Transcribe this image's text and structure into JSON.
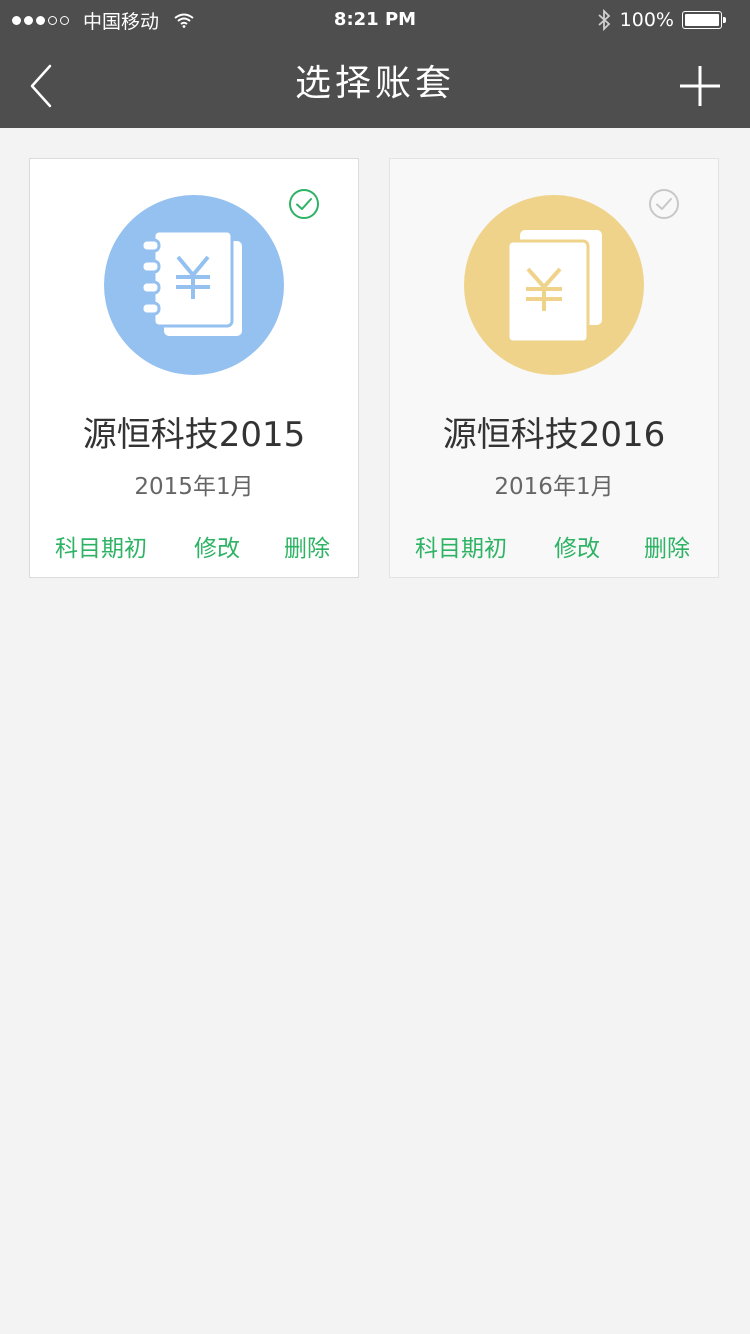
{
  "status_bar": {
    "carrier": "中国移动",
    "time": "8:21 PM",
    "battery": "100%",
    "signal_bars_filled": 3,
    "signal_bars_total": 5
  },
  "nav": {
    "title": "选择账套",
    "back_icon": "chevron-left-icon",
    "add_icon": "plus-icon"
  },
  "colors": {
    "bar_bg": "#4e4e4e",
    "page_bg": "#f3f3f3",
    "accent_green": "#2eb365",
    "blue_circle": "#94c1f0",
    "yellow_circle": "#efd38a"
  },
  "books": [
    {
      "name": "源恒科技2015",
      "date": "2015年1月",
      "selected": true,
      "icon": "ledger-book-yen-icon",
      "actions": [
        "科目期初",
        "修改",
        "删除"
      ]
    },
    {
      "name": "源恒科技2016",
      "date": "2016年1月",
      "selected": false,
      "icon": "document-yen-icon",
      "actions": [
        "科目期初",
        "修改",
        "删除"
      ]
    }
  ]
}
